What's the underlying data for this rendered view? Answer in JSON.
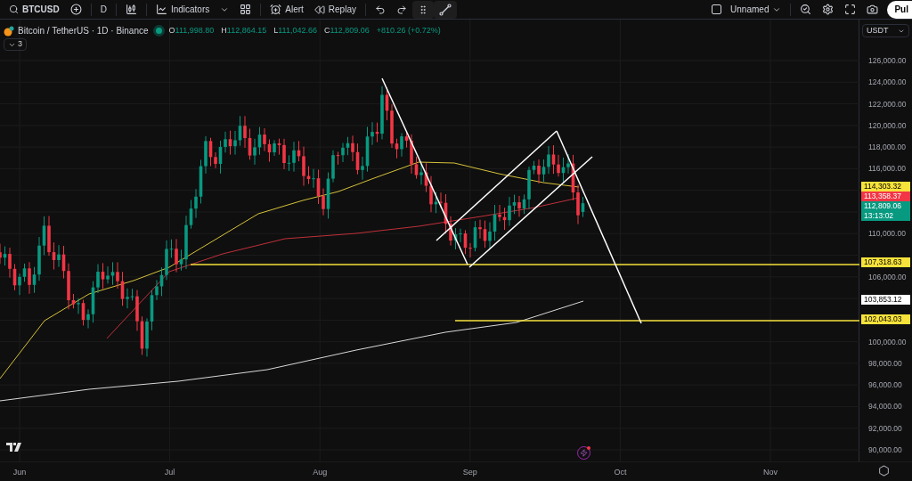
{
  "toolbar": {
    "symbol": "BTCUSD",
    "interval": "D",
    "indicators": "Indicators",
    "alert": "Alert",
    "replay": "Replay",
    "layout_name": "Unnamed",
    "publish": "Pul",
    "layout_checked": false
  },
  "legend": {
    "title": "Bitcoin / TetherUS · 1D · Binance",
    "market_open": true,
    "ohlc": [
      {
        "label": "O",
        "value": "111,998.80"
      },
      {
        "label": "H",
        "value": "112,864.15"
      },
      {
        "label": "L",
        "value": "111,042.66"
      },
      {
        "label": "C",
        "value": "112,809.06"
      }
    ],
    "change": "+810.26 (+0.72%)",
    "indicators_count": "3"
  },
  "currency": "USDT",
  "price_axis": [
    "126,000.00",
    "124,000.00",
    "122,000.00",
    "120,000.00",
    "118,000.00",
    "116,000.00",
    "110,000.00",
    "106,000.00",
    "100,000.00",
    "98,000.00",
    "96,000.00",
    "94,000.00",
    "92,000.00",
    "90,000.00"
  ],
  "price_labels": [
    {
      "text": "114,303.32",
      "color": "#f7e23b"
    },
    {
      "text": "113,358.37",
      "color": "#f23645"
    },
    {
      "text": "112,809.06",
      "countdown": "13:13:02",
      "color": "#089981"
    },
    {
      "text": "107,318.63",
      "color": "#f7e23b"
    },
    {
      "text": "103,853.12",
      "color": "#ffffff"
    },
    {
      "text": "102,043.03",
      "color": "#f7e23b"
    }
  ],
  "time_axis": [
    "Jun",
    "Jul",
    "Aug",
    "Sep",
    "Oct",
    "Nov"
  ]
}
